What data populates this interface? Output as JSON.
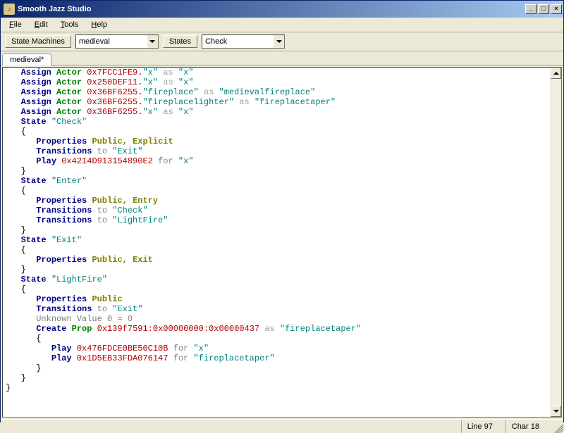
{
  "window": {
    "title": "Smooth Jazz Studio"
  },
  "menubar": {
    "file": "File",
    "edit": "Edit",
    "tools": "Tools",
    "help": "Help"
  },
  "toolbar": {
    "state_machines_label": "State Machines",
    "state_machines_value": "medieval",
    "states_label": "States",
    "states_value": "Check"
  },
  "tabs": {
    "active": "medieval*"
  },
  "status": {
    "line_label": "Line",
    "line": "97",
    "char_label": "Char",
    "char": "18"
  },
  "code": {
    "lines": [
      {
        "t": "assign",
        "actor": "Actor",
        "hex": "0x7FCC1FE9",
        "field": "x",
        "alias": "x"
      },
      {
        "t": "assign",
        "actor": "Actor",
        "hex": "0x250DEF11",
        "field": "x",
        "alias": "x"
      },
      {
        "t": "assign",
        "actor": "Actor",
        "hex": "0x36BF6255",
        "field": "fireplace",
        "alias": "medievalfireplace"
      },
      {
        "t": "assign",
        "actor": "Actor",
        "hex": "0x36BF6255",
        "field": "fireplacelighter",
        "alias": "fireplacetaper"
      },
      {
        "t": "assign",
        "actor": "Actor",
        "hex": "0x36BF6255",
        "field": "x",
        "alias": "x"
      },
      {
        "t": "state",
        "name": "Check"
      },
      {
        "t": "brace",
        "c": "{"
      },
      {
        "t": "props",
        "vals": [
          "Public",
          "Explicit"
        ]
      },
      {
        "t": "trans",
        "to": "Exit"
      },
      {
        "t": "play",
        "hex": "0x4214D913154890E2",
        "for": "x"
      },
      {
        "t": "brace",
        "c": "}"
      },
      {
        "t": "state",
        "name": "Enter"
      },
      {
        "t": "brace",
        "c": "{"
      },
      {
        "t": "props",
        "vals": [
          "Public",
          "Entry"
        ]
      },
      {
        "t": "trans",
        "to": "Check"
      },
      {
        "t": "trans",
        "to": "LightFire"
      },
      {
        "t": "brace",
        "c": "}"
      },
      {
        "t": "state",
        "name": "Exit"
      },
      {
        "t": "brace",
        "c": "{"
      },
      {
        "t": "props",
        "vals": [
          "Public",
          "Exit"
        ]
      },
      {
        "t": "brace",
        "c": "}"
      },
      {
        "t": "state",
        "name": "LightFire"
      },
      {
        "t": "brace",
        "c": "{"
      },
      {
        "t": "props",
        "vals": [
          "Public"
        ]
      },
      {
        "t": "trans",
        "to": "Exit"
      },
      {
        "t": "unknown",
        "text": "Unknown Value 0 = 0"
      },
      {
        "t": "create",
        "kind": "Prop",
        "hex": "0x139f7591:0x00000000:0x00000437",
        "alias": "fireplacetaper"
      },
      {
        "t": "brace2",
        "c": "{"
      },
      {
        "t": "play2",
        "hex": "0x476FDCE0BE50C10B",
        "for": "x"
      },
      {
        "t": "play2",
        "hex": "0x1D5EB33FDA076147",
        "for": "fireplacetaper"
      },
      {
        "t": "brace2",
        "c": "}"
      },
      {
        "t": "brace",
        "c": "}"
      },
      {
        "t": "close",
        "c": "}"
      }
    ]
  }
}
